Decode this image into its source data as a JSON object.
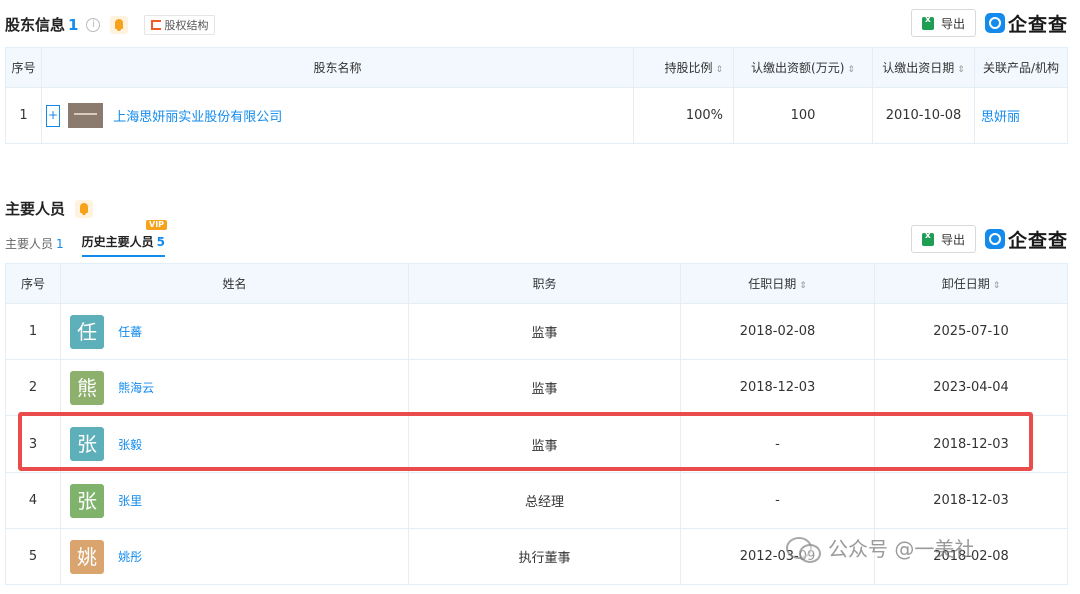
{
  "shareholders": {
    "title": "股东信息",
    "count": "1",
    "equity_button": "股权结构",
    "export_label": "导出",
    "brand": "企查查",
    "columns": {
      "index": "序号",
      "name": "股东名称",
      "ratio": "持股比例",
      "amount": "认缴出资额(万元)",
      "date": "认缴出资日期",
      "related": "关联产品/机构"
    },
    "rows": [
      {
        "index": "1",
        "expand": "+",
        "name": "上海思妍丽实业股份有限公司",
        "ratio": "100%",
        "amount": "100",
        "date": "2010-10-08",
        "related": "思妍丽"
      }
    ]
  },
  "personnel": {
    "title": "主要人员",
    "tabs": [
      {
        "label": "主要人员",
        "count": "1"
      },
      {
        "label": "历史主要人员",
        "count": "5",
        "badge": "VIP"
      }
    ],
    "export_label": "导出",
    "brand": "企查查",
    "columns": {
      "index": "序号",
      "name": "姓名",
      "position": "职务",
      "start": "任职日期",
      "end": "卸任日期"
    },
    "rows": [
      {
        "index": "1",
        "avatar": "任",
        "avatar_color": "#5dafb9",
        "name": "任蕃",
        "position": "监事",
        "start": "2018-02-08",
        "end": "2025-07-10"
      },
      {
        "index": "2",
        "avatar": "熊",
        "avatar_color": "#8db06d",
        "name": "熊海云",
        "position": "监事",
        "start": "2018-12-03",
        "end": "2023-04-04"
      },
      {
        "index": "3",
        "avatar": "张",
        "avatar_color": "#5dafb9",
        "name": "张毅",
        "position": "监事",
        "start": "-",
        "end": "2018-12-03"
      },
      {
        "index": "4",
        "avatar": "张",
        "avatar_color": "#7fb36b",
        "name": "张里",
        "position": "总经理",
        "start": "-",
        "end": "2018-12-03"
      },
      {
        "index": "5",
        "avatar": "姚",
        "avatar_color": "#d9a46e",
        "name": "姚彤",
        "position": "执行董事",
        "start": "2012-03-09",
        "end": "2018-02-08"
      }
    ]
  },
  "watermark": "公众号 @一美社"
}
